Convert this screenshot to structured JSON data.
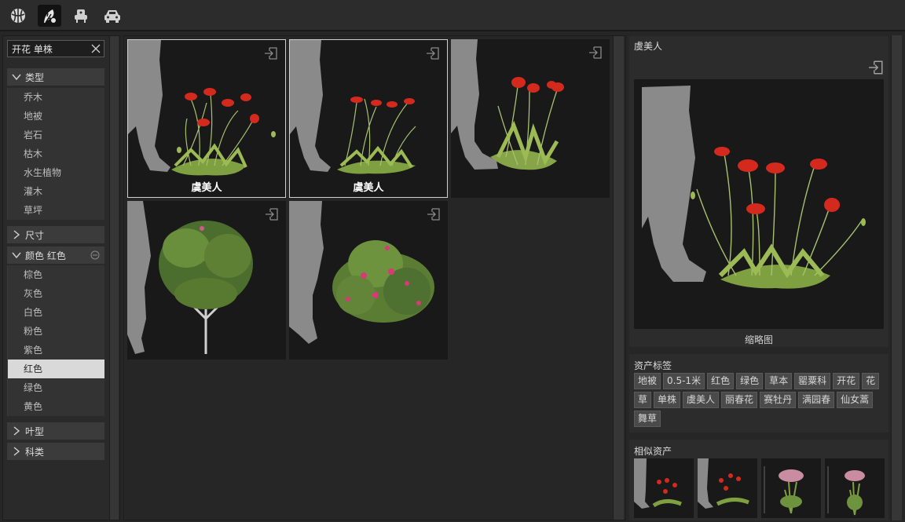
{
  "toolbar": {
    "icons": [
      "globe-icon",
      "plant-icon",
      "furniture-icon",
      "car-icon"
    ],
    "active_icon": "plant-icon"
  },
  "search": {
    "value": "开花 单株",
    "placeholder": ""
  },
  "categories": {
    "type": {
      "label": "类型",
      "items": [
        "乔木",
        "地被",
        "岩石",
        "枯木",
        "水生植物",
        "灌木",
        "草坪"
      ]
    },
    "size": {
      "label": "尺寸"
    },
    "color": {
      "label": "颜色 红色",
      "items": [
        "棕色",
        "灰色",
        "白色",
        "粉色",
        "紫色",
        "红色",
        "绿色",
        "黄色"
      ],
      "selected": "红色"
    },
    "leaf": {
      "label": "叶型"
    },
    "family": {
      "label": "科类"
    }
  },
  "grid": {
    "tiles": [
      {
        "label": "虞美人",
        "kind": "poppy"
      },
      {
        "label": "虞美人",
        "kind": "poppy"
      },
      {
        "label": "",
        "kind": "poppy"
      },
      {
        "label": "",
        "kind": "tree"
      },
      {
        "label": "",
        "kind": "rose-shrub"
      }
    ]
  },
  "detail": {
    "title": "虞美人",
    "caption": "缩略图",
    "tags_title": "资产标签",
    "tags": [
      "地被",
      "0.5-1米",
      "红色",
      "绿色",
      "草本",
      "罂粟科",
      "开花",
      "花",
      "草",
      "单株",
      "虞美人",
      "丽春花",
      "赛牡丹",
      "满园春",
      "仙女蒿",
      "舞草"
    ],
    "similar_title": "相似资产"
  },
  "colors": {
    "background": "#262626",
    "panel": "#2c2c2c",
    "selected_item": "#d9d9d9",
    "poppy_red": "#d42a1e",
    "foliage_green": "#8fb04a"
  }
}
